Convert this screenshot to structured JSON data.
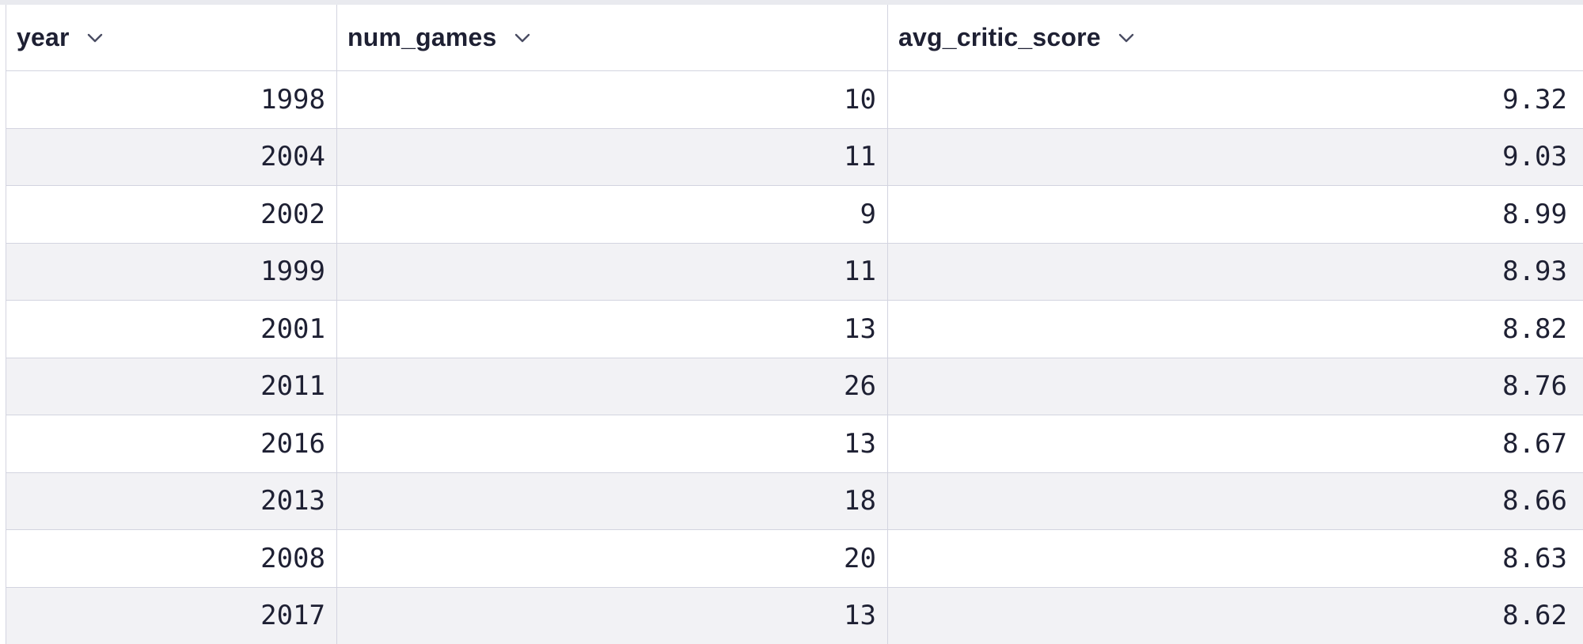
{
  "table": {
    "columns": [
      {
        "label": "year"
      },
      {
        "label": "num_games"
      },
      {
        "label": "avg_critic_score"
      }
    ],
    "rows": [
      {
        "year": "1998",
        "num_games": "10",
        "avg_critic_score": "9.32"
      },
      {
        "year": "2004",
        "num_games": "11",
        "avg_critic_score": "9.03"
      },
      {
        "year": "2002",
        "num_games": "9",
        "avg_critic_score": "8.99"
      },
      {
        "year": "1999",
        "num_games": "11",
        "avg_critic_score": "8.93"
      },
      {
        "year": "2001",
        "num_games": "13",
        "avg_critic_score": "8.82"
      },
      {
        "year": "2011",
        "num_games": "26",
        "avg_critic_score": "8.76"
      },
      {
        "year": "2016",
        "num_games": "13",
        "avg_critic_score": "8.67"
      },
      {
        "year": "2013",
        "num_games": "18",
        "avg_critic_score": "8.66"
      },
      {
        "year": "2008",
        "num_games": "20",
        "avg_critic_score": "8.63"
      },
      {
        "year": "2017",
        "num_games": "13",
        "avg_critic_score": "8.62"
      }
    ]
  },
  "icons": {
    "sort_menu": "chevron-down-icon"
  }
}
